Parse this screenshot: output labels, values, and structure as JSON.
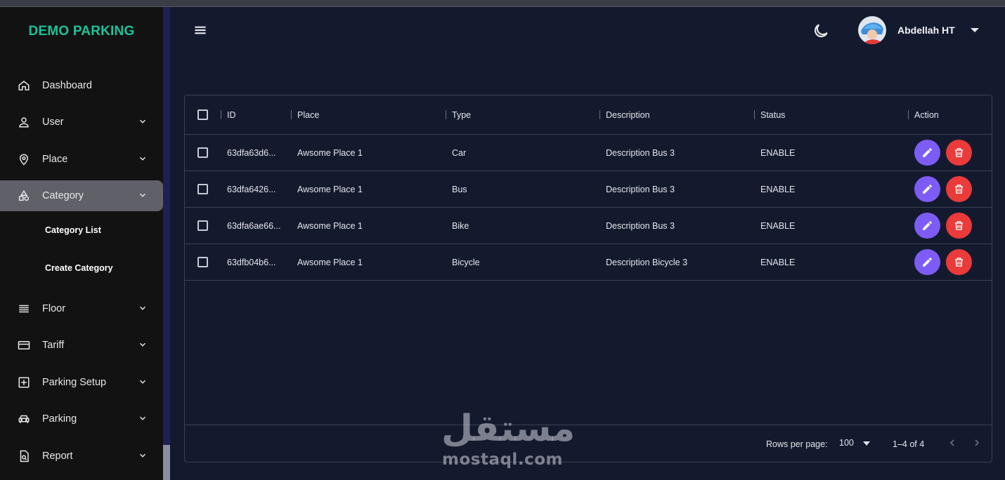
{
  "app": {
    "brand": "DEMO PARKING"
  },
  "sidebar": {
    "items": [
      {
        "label": "Dashboard",
        "icon": "home-icon",
        "has_chevron": false
      },
      {
        "label": "User",
        "icon": "person-icon",
        "has_chevron": true
      },
      {
        "label": "Place",
        "icon": "location-pin-icon",
        "has_chevron": true
      },
      {
        "label": "Category",
        "icon": "category-shapes-icon",
        "has_chevron": true,
        "active": true
      },
      {
        "label": "Floor",
        "icon": "list-lines-icon",
        "has_chevron": true
      },
      {
        "label": "Tariff",
        "icon": "credit-card-icon",
        "has_chevron": true
      },
      {
        "label": "Parking Setup",
        "icon": "add-box-icon",
        "has_chevron": true
      },
      {
        "label": "Parking",
        "icon": "car-icon",
        "has_chevron": true
      },
      {
        "label": "Report",
        "icon": "report-file-icon",
        "has_chevron": true
      }
    ],
    "category_sub": [
      "Category List",
      "Create Category"
    ]
  },
  "header": {
    "user_name": "Abdellah HT",
    "icons": [
      "menu-icon",
      "moon-icon",
      "caret-down-icon"
    ]
  },
  "table": {
    "columns": [
      "ID",
      "Place",
      "Type",
      "Description",
      "Status",
      "Action"
    ],
    "rows": [
      {
        "id": "63dfa63d6...",
        "place": "Awsome Place 1",
        "type": "Car",
        "description": "Description Bus 3",
        "status": "ENABLE"
      },
      {
        "id": "63dfa6426...",
        "place": "Awsome Place 1",
        "type": "Bus",
        "description": "Description Bus 3",
        "status": "ENABLE"
      },
      {
        "id": "63dfa6ae66...",
        "place": "Awsome Place 1",
        "type": "Bike",
        "description": "Description Bus 3",
        "status": "ENABLE"
      },
      {
        "id": "63dfb04b6...",
        "place": "Awsome Place 1",
        "type": "Bicycle",
        "description": "Description Bicycle 3",
        "status": "ENABLE"
      }
    ],
    "footer": {
      "rows_per_page_label": "Rows per page:",
      "rows_per_page_value": "100",
      "range": "1–4 of 4"
    }
  },
  "watermark": {
    "arabic": "مستقل",
    "latin": "mostaql.com"
  },
  "colors": {
    "brand": "#19c39b",
    "edit": "#7c5cf5",
    "delete": "#ea3a3a",
    "background": "#141a2e",
    "sidebar": "#121212"
  }
}
